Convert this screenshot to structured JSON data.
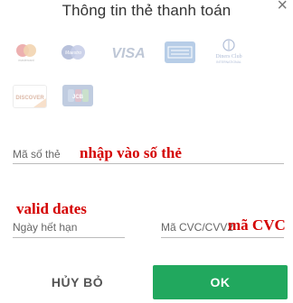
{
  "dialog": {
    "title": "Thông tin thẻ thanh toán",
    "close_icon": "close-icon"
  },
  "card_logos": [
    {
      "name": "mastercard",
      "label": "mastercard"
    },
    {
      "name": "maestro",
      "label": "Maestro"
    },
    {
      "name": "visa",
      "label": "VISA"
    },
    {
      "name": "amex",
      "label": "AMERICAN EXPRESS"
    },
    {
      "name": "diners",
      "label": "Diners Club",
      "sublabel": "INTERNATIONAL"
    },
    {
      "name": "discover",
      "label": "DISCOVER"
    },
    {
      "name": "jcb",
      "label": "JCB"
    }
  ],
  "form": {
    "card_number": {
      "label": "Mã số thẻ",
      "annotation": "nhập vào số thẻ"
    },
    "expiry": {
      "label": "Ngày hết hạn",
      "annotation": "valid dates"
    },
    "cvc": {
      "label": "Mã CVC/CVV2",
      "annotation": "mã CVC"
    }
  },
  "buttons": {
    "cancel": "HỦY BỎ",
    "ok": "OK"
  },
  "colors": {
    "primary": "#21a85e",
    "annotation": "#d40000"
  }
}
